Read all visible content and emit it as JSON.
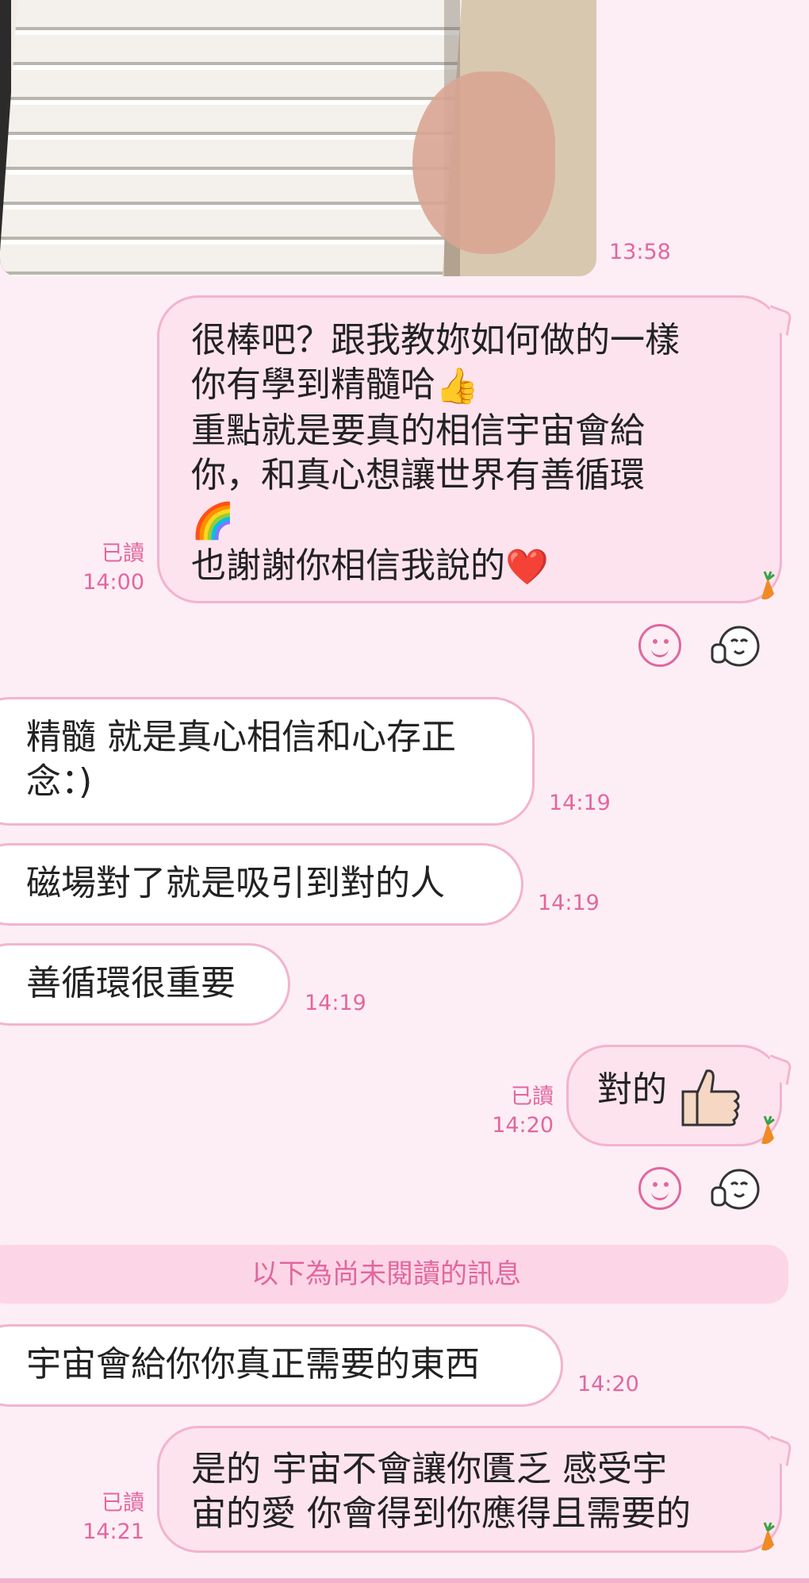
{
  "messages": {
    "photo_time": "13:58",
    "m1": {
      "lines": [
        "很棒吧？跟我教妳如何做的一樣",
        "你有學到精髓哈",
        "重點就是要真的相信宇宙會給",
        "你，和真心想讓世界有善循環",
        "",
        "也謝謝你相信我說的"
      ],
      "emoji_thumb": "👍",
      "emoji_rainbow": "🌈",
      "emoji_heart": "❤️",
      "read_label": "已讀",
      "time": "14:00"
    },
    "m2": {
      "lines": [
        "精髓 就是真心相信和心存正",
        "念：)"
      ],
      "time": "14:19"
    },
    "m3": {
      "text": "磁場對了就是吸引到對的人",
      "time": "14:19"
    },
    "m4": {
      "text": "善循環很重要",
      "time": "14:19"
    },
    "m5": {
      "text": "對的",
      "read_label": "已讀",
      "time": "14:20"
    },
    "divider": "以下為尚未閱讀的訊息",
    "m6": {
      "text": "宇宙會給你你真正需要的東西",
      "time": "14:20"
    },
    "m7": {
      "lines": [
        "是的 宇宙不會讓你匱乏 感受宇",
        "宙的愛 你會得到你應得且需要的"
      ],
      "read_label": "已讀",
      "time": "14:21"
    }
  },
  "icons": {
    "reaction": "smiley-face-icon",
    "sticker": "thumbs-up-character-icon",
    "carrot": "carrot-icon"
  },
  "colors": {
    "accent": "#e2669f",
    "background": "#fdeef5",
    "bubble_out": "#fde3ee",
    "bubble_border": "#f3b3cf"
  }
}
